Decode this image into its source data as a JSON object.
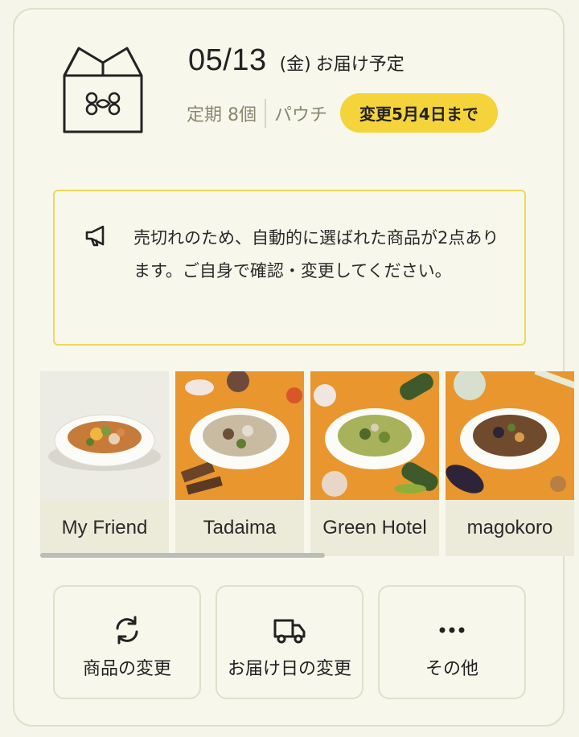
{
  "delivery": {
    "date": "05/13",
    "weekday": "(金)",
    "label": "お届け予定",
    "plan": "定期 8個",
    "package": "パウチ",
    "deadline": "変更5月4日まで",
    "box_logo_icon": "box-logo-icon"
  },
  "notice": {
    "icon": "megaphone-icon",
    "message": "売切れのため、自動的に選ばれた商品が2点あります。ご自身で確認・変更してください。"
  },
  "products": [
    {
      "name": "My Friend",
      "accent": "#f0b23a"
    },
    {
      "name": "Tadaima",
      "accent": "#e99a32"
    },
    {
      "name": "Green Hotel",
      "accent": "#8aa24a"
    },
    {
      "name": "magokoro",
      "accent": "#6b4a2e"
    }
  ],
  "actions": [
    {
      "label": "商品の変更",
      "icon": "refresh-icon"
    },
    {
      "label": "お届け日の変更",
      "icon": "truck-icon"
    },
    {
      "label": "その他",
      "icon": "more-icon"
    }
  ],
  "colors": {
    "accent_yellow": "#f4d33b",
    "background": "#f8f7ec",
    "notice_border": "#eed85a",
    "muted_text": "#8a876e"
  }
}
